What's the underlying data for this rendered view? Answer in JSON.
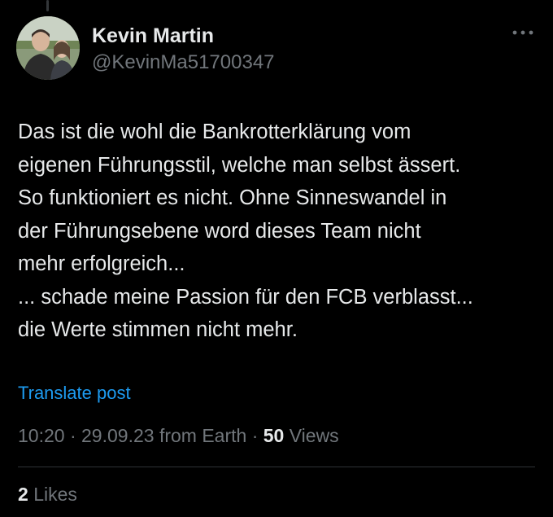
{
  "author": {
    "display_name": "Kevin Martin",
    "handle": "@KevinMa51700347",
    "avatar_icon": "profile-photo"
  },
  "menu": {
    "icon": "more-options-icon"
  },
  "post": {
    "text": "Das ist die wohl die Bankrotterklärung vom\neigenen Führungsstil, welche man selbst ässert.\nSo funktioniert es nicht. Ohne Sinneswandel in\nder Führungsebene word dieses Team nicht\nmehr erfolgreich...\n... schade meine Passion für den FCB verblasst...\ndie Werte stimmen nicht mehr."
  },
  "translate": {
    "label": "Translate post"
  },
  "meta": {
    "time": "10:20",
    "separator": " · ",
    "date": "29.09.23",
    "source": "from Earth",
    "views_count": "50",
    "views_label": "Views"
  },
  "stats": {
    "likes_count": "2",
    "likes_label": "Likes"
  },
  "colors": {
    "background": "#000000",
    "primary_text": "#e7e9ea",
    "secondary_text": "#71767b",
    "link": "#1d9bf0",
    "divider": "#2f3336"
  }
}
